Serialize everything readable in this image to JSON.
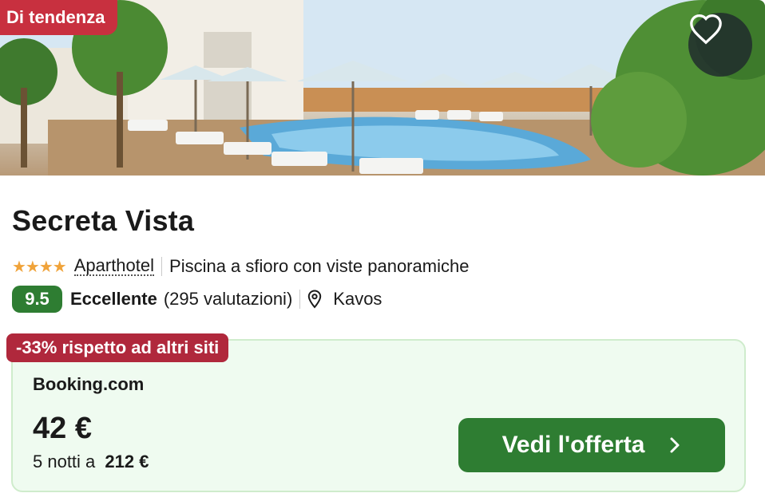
{
  "hero": {
    "badge": "Di tendenza"
  },
  "hotel": {
    "name": "Secreta Vista",
    "stars": "★★★★",
    "type": "Aparthotel",
    "feature": "Piscina a sfioro con viste panoramiche",
    "score": "9.5",
    "rating_label": "Eccellente",
    "reviews": "(295 valutazioni)",
    "location": "Kavos"
  },
  "offer": {
    "discount": "-33% rispetto ad altri siti",
    "site": "Booking.com",
    "price": "42 €",
    "nights_prefix": "5 notti a",
    "total": "212 €",
    "cta": "Vedi l'offerta"
  },
  "colors": {
    "brand_green": "#2e7d32",
    "badge_red": "#c8303f",
    "discount_red": "#b0283c",
    "offer_bg": "#effbf0",
    "star": "#f0a33a"
  },
  "icons": [
    "heart-icon",
    "map-pin-icon",
    "chevron-right-icon"
  ]
}
